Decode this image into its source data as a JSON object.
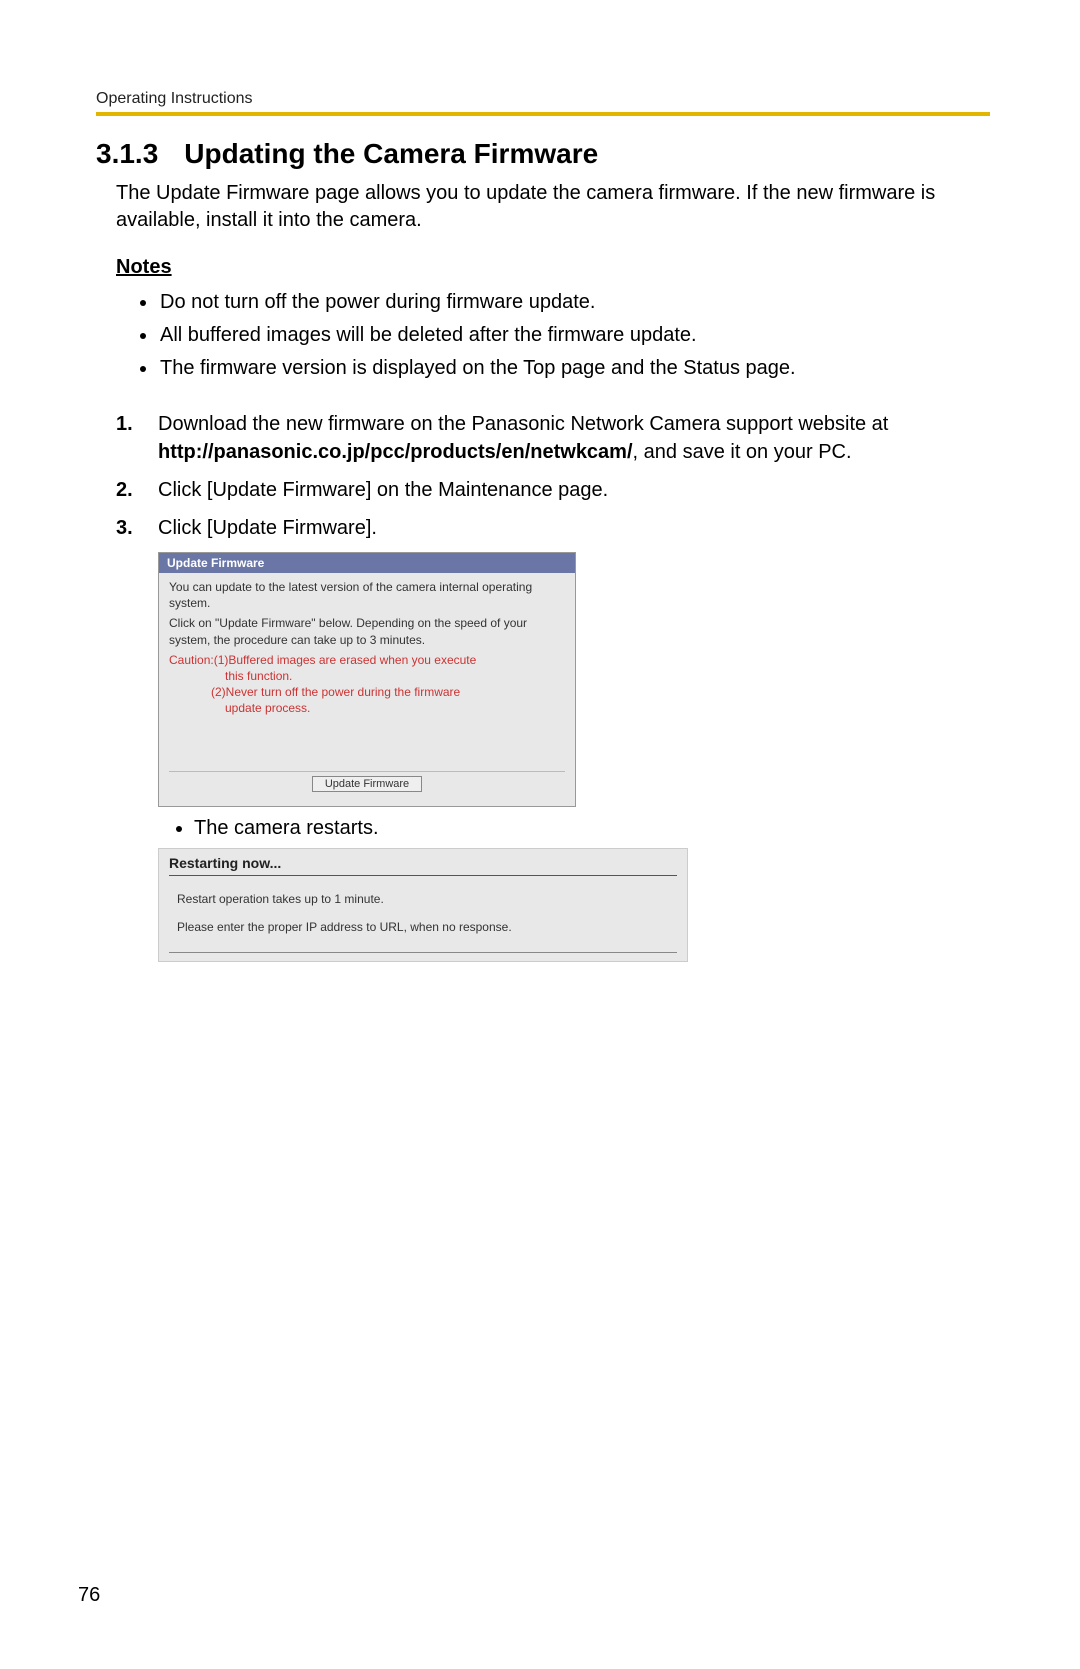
{
  "running_head": "Operating Instructions",
  "section": {
    "number": "3.1.3",
    "title": "Updating the Camera Firmware"
  },
  "intro": "The Update Firmware page allows you to update the camera firmware. If the new firmware is available, install it into the camera.",
  "notes_heading": "Notes",
  "notes": [
    "Do not turn off the power during firmware update.",
    "All buffered images will be deleted after the firmware update.",
    "The firmware version is displayed on the Top page and the Status page."
  ],
  "steps": {
    "s1_before": "Download the new firmware on the Panasonic Network Camera support website at ",
    "s1_url": "http://panasonic.co.jp/pcc/products/en/netwkcam/",
    "s1_after": ", and save it on your PC.",
    "s2": "Click [Update Firmware] on the Maintenance page.",
    "s3": "Click [Update Firmware]."
  },
  "fw_dialog": {
    "title": "Update Firmware",
    "desc1": "You can update to the latest version of the camera internal operating system.",
    "desc2": "Click on \"Update Firmware\" below. Depending on the speed of your system, the procedure can take up to 3 minutes.",
    "caution_label": "Caution:",
    "caution1_num": "(1)",
    "caution1a": "Buffered images are erased when you execute",
    "caution1b": "this function.",
    "caution2_num": "(2)",
    "caution2a": "Never turn off the power during the firmware",
    "caution2b": "update process.",
    "button": "Update Firmware"
  },
  "sub_bullet": "The camera restarts.",
  "restart_dialog": {
    "title": "Restarting now...",
    "line1": "Restart operation takes up to 1 minute.",
    "line2": "Please enter the proper IP address to URL, when no response."
  },
  "page_number": "76"
}
